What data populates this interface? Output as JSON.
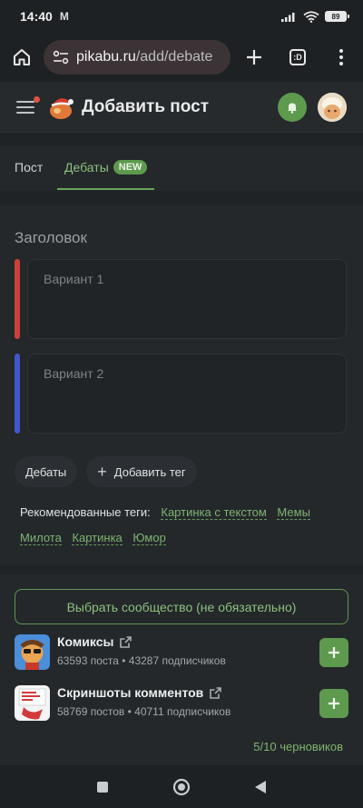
{
  "status_bar": {
    "time": "14:40",
    "mail_icon": "M",
    "battery": "89"
  },
  "browser": {
    "url_domain": "pikabu.ru",
    "url_path": "/add/debate",
    "tabs_label": ":D"
  },
  "header": {
    "title": "Добавить пост"
  },
  "tabs": [
    {
      "label": "Пост"
    },
    {
      "label": "Дебаты",
      "badge": "NEW"
    }
  ],
  "form": {
    "title_placeholder": "Заголовок",
    "variant1_placeholder": "Вариант 1",
    "variant2_placeholder": "Вариант 2",
    "variant1_color": "#c9423a",
    "variant2_color": "#4257c9",
    "tag_chip": "Дебаты",
    "add_tag_label": "Добавить тег",
    "recommended_label": "Рекомендованные теги:",
    "recommended_tags": [
      "Картинка с текстом",
      "Мемы",
      "Милота",
      "Картинка",
      "Юмор"
    ]
  },
  "community": {
    "choose_label": "Выбрать сообщество (не обязательно)",
    "items": [
      {
        "name": "Комиксы",
        "meta": "63593 поста • 43287 подписчиков",
        "icon": "comics-icon"
      },
      {
        "name": "Скриншоты комментов",
        "meta": "58769 постов • 40711 подписчиков",
        "icon": "screenshots-icon"
      }
    ],
    "drafts": "5/10 черновиков"
  },
  "colors": {
    "accent": "#5d9a4e",
    "accent_text": "#7fb46f",
    "background": "#1f2326",
    "card": "#24282b"
  }
}
